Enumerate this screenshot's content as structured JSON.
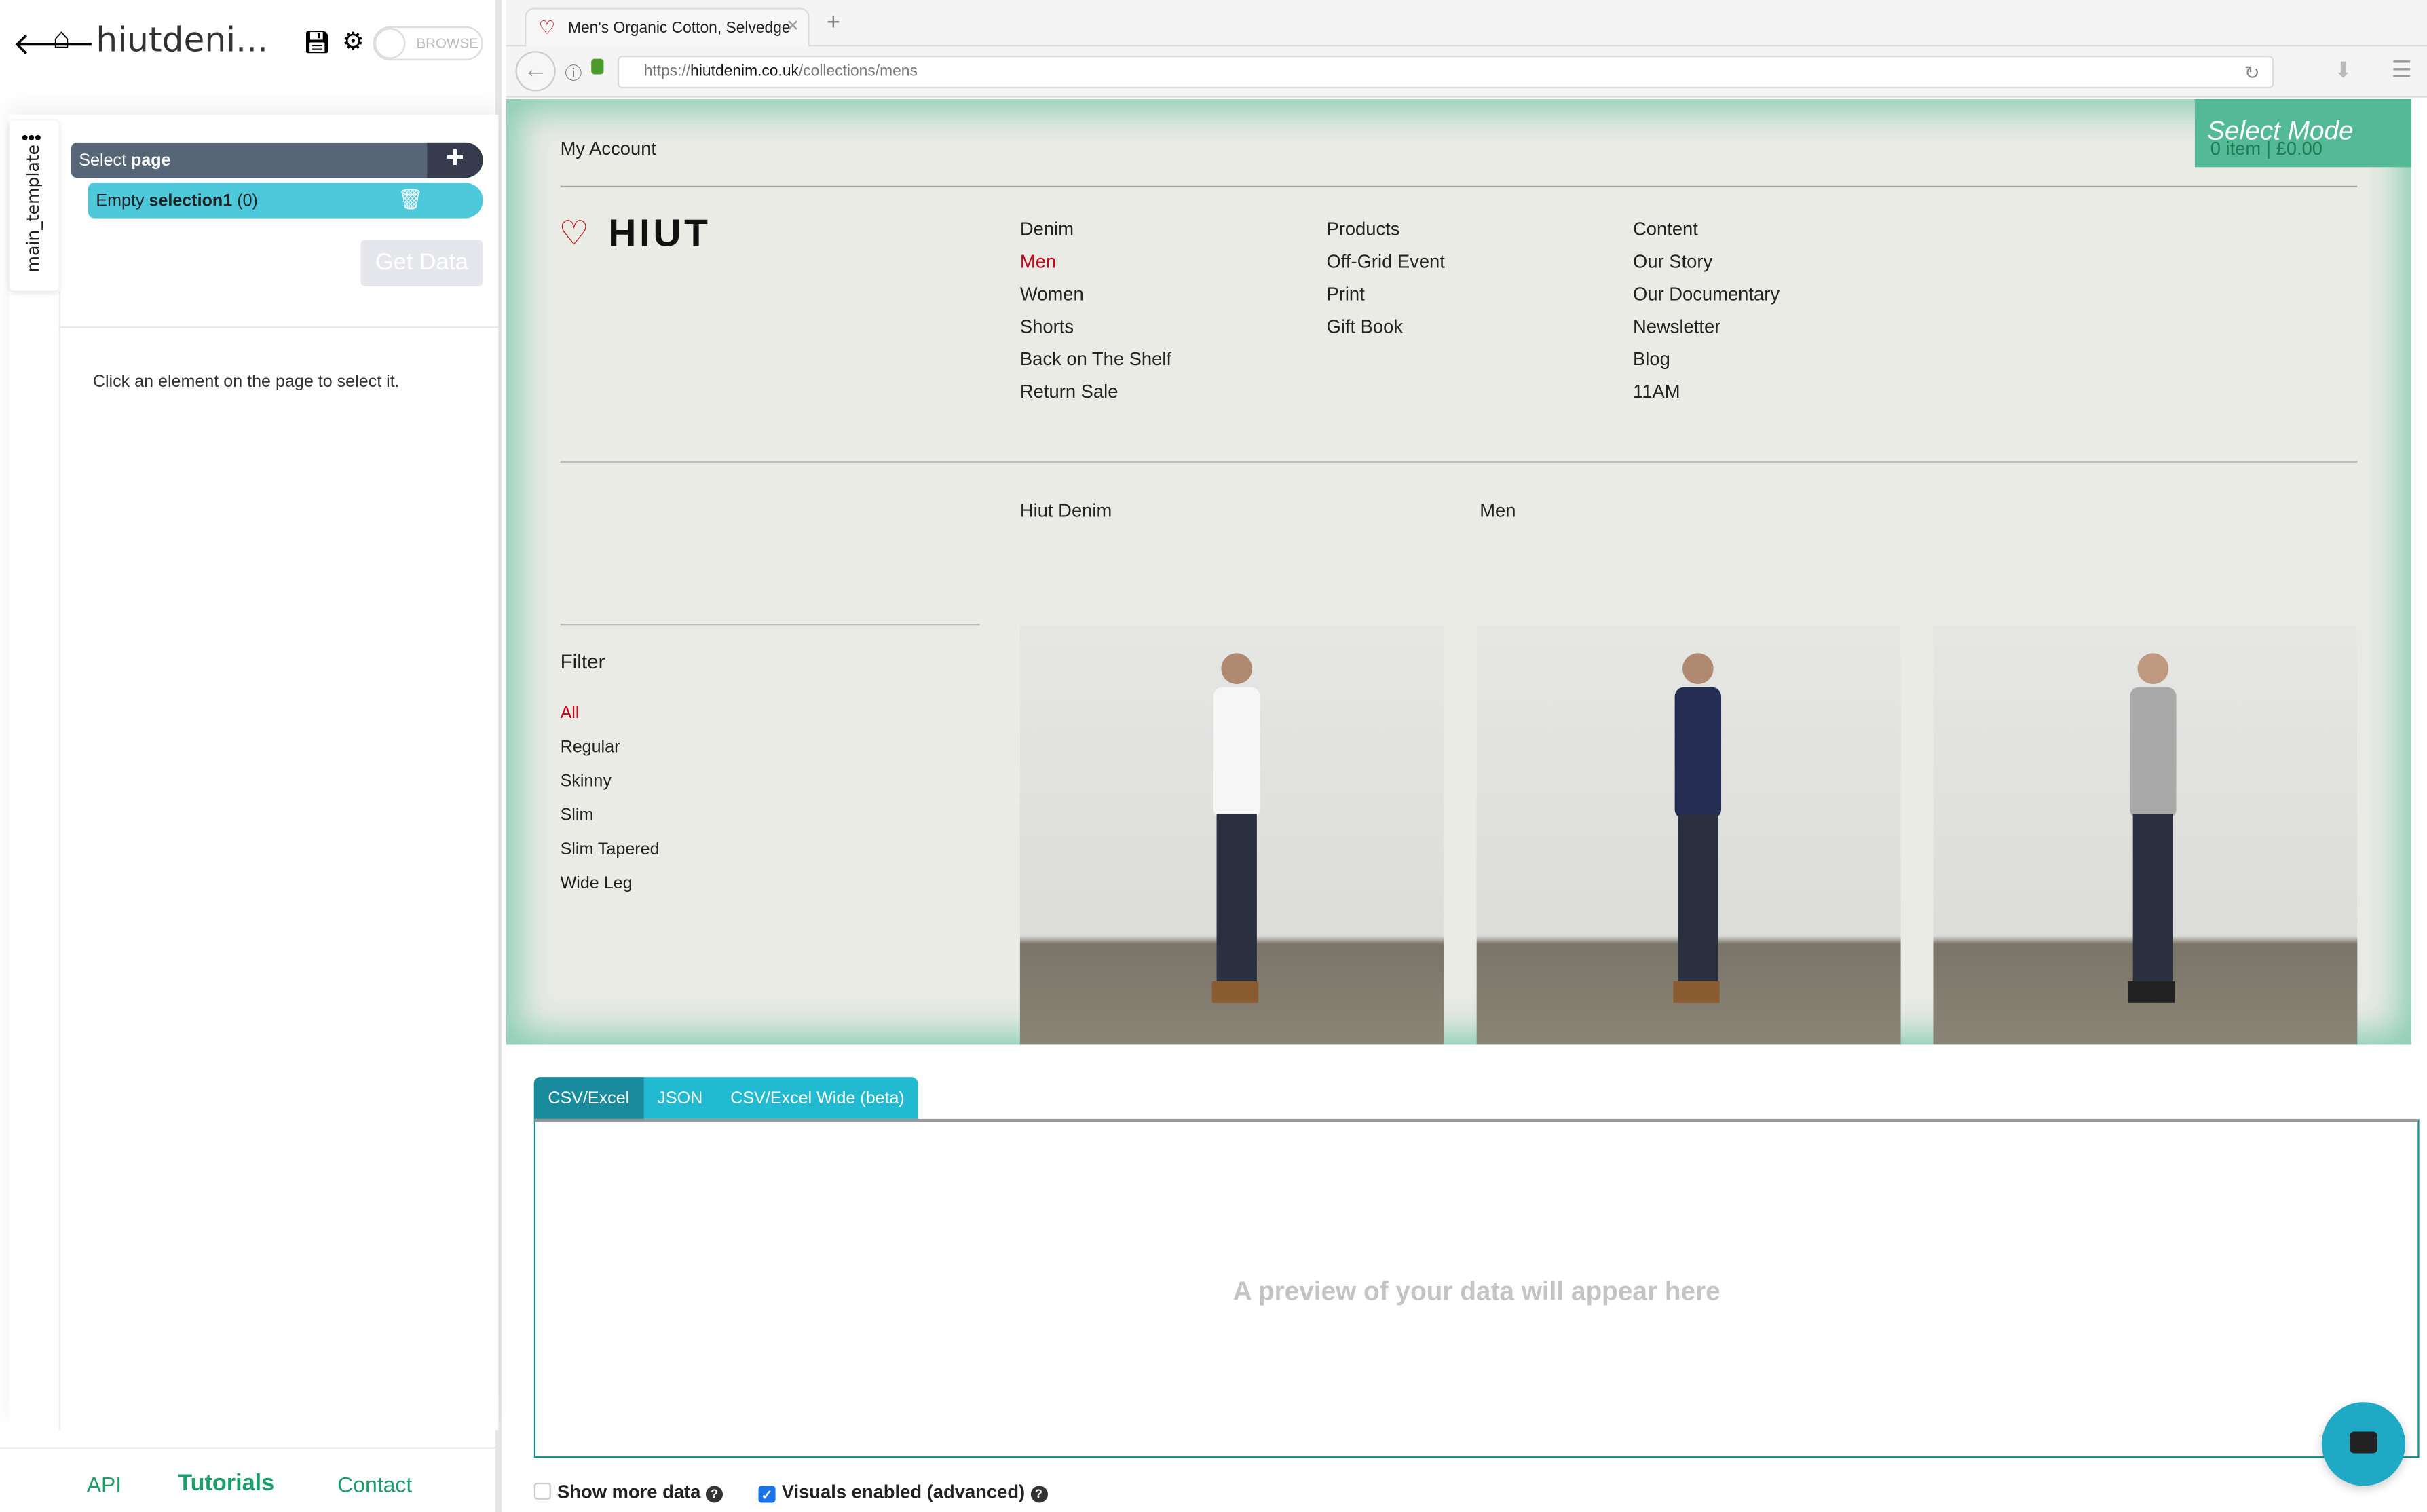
{
  "sidebar": {
    "title": "hiutdeni...",
    "toggle_label": "BROWSE",
    "template_name": "main_template",
    "select_prefix": "Select",
    "select_target": "page",
    "selection_prefix": "Empty",
    "selection_name": "selection1",
    "selection_count": "(0)",
    "get_data": "Get Data",
    "hint": "Click an element on the page to select it.",
    "footer": {
      "api": "API",
      "tutorials": "Tutorials",
      "contact": "Contact"
    }
  },
  "browser": {
    "tab_title": "Men's Organic Cotton, Selvedge",
    "url_prefix": "https://",
    "url_host": "hiutdenim.co.uk",
    "url_path": "/collections/mens"
  },
  "site": {
    "my_account": "My Account",
    "logo": "HIUT",
    "select_mode": "Select Mode",
    "cart": "0 item | £0.00",
    "nav_col1": [
      "Denim",
      "Men",
      "Women",
      "Shorts",
      "Back on The Shelf",
      "Return Sale"
    ],
    "nav_col2": [
      "Products",
      "Off-Grid Event",
      "Print",
      "Gift Book"
    ],
    "nav_col3": [
      "Content",
      "Our Story",
      "Our Documentary",
      "Newsletter",
      "Blog",
      "11AM"
    ],
    "breadcrumb": [
      "Hiut Denim",
      "Men"
    ],
    "filter_title": "Filter",
    "filters": [
      "All",
      "Regular",
      "Skinny",
      "Slim",
      "Slim Tapered",
      "Wide Leg"
    ],
    "active_color": "#d0021b"
  },
  "results": {
    "tabs": [
      "CSV/Excel",
      "JSON",
      "CSV/Excel Wide (beta)"
    ],
    "placeholder": "A preview of your data will appear here",
    "show_more": "Show more data",
    "show_more_checked": false,
    "visuals": "Visuals enabled (advanced)",
    "visuals_checked": true
  },
  "colors": {
    "accent": "#22bad1",
    "green": "#1b9e6a",
    "select_mode": "#53b997"
  }
}
